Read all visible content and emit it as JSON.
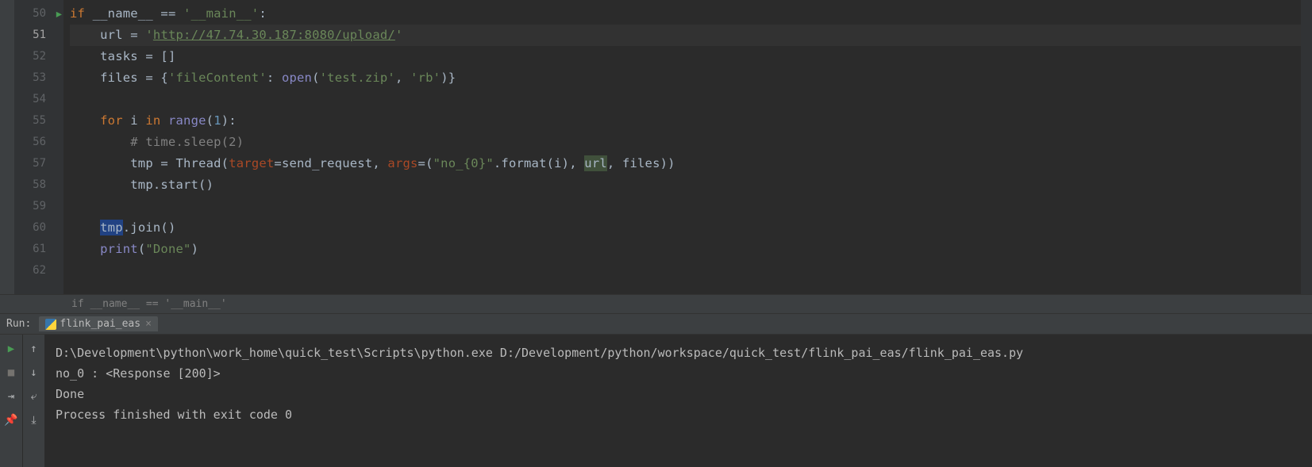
{
  "gutter": {
    "lines": [
      50,
      51,
      52,
      53,
      54,
      55,
      56,
      57,
      58,
      59,
      60,
      61,
      62
    ],
    "current": 51
  },
  "code": {
    "l50": {
      "kw_if": "if",
      "name": " __name__ ",
      "eq": "== ",
      "str": "'__main__'",
      "colon": ":"
    },
    "l51": {
      "var": "url ",
      "eq": "= ",
      "q1": "'",
      "url": "http://47.74.30.187:8080/upload/",
      "q2": "'"
    },
    "l52": {
      "var": "tasks ",
      "eq": "= ",
      "brk": "[]"
    },
    "l53": {
      "var": "files ",
      "eq": "= {",
      "key": "'fileContent'",
      "colon": ": ",
      "open": "open",
      "p1": "(",
      "s1": "'test.zip'",
      "comma": ", ",
      "s2": "'rb'",
      "p2": ")}"
    },
    "l55": {
      "for": "for ",
      "i": "i ",
      "in": "in ",
      "range": "range",
      "p1": "(",
      "n": "1",
      "p2": "):"
    },
    "l56": {
      "c": "# time.sleep(2)"
    },
    "l57": {
      "tmp": "tmp ",
      "eq": "= ",
      "th": "Thread(",
      "target": "target",
      "eq2": "=send_request, ",
      "args": "args",
      "eq3": "=(",
      "s": "\"no_{0}\"",
      "fmt": ".format(i), ",
      "url": "url",
      "rest": ", files))"
    },
    "l58": {
      "txt": "tmp.start()"
    },
    "l60": {
      "tmp": "tmp",
      "rest": ".join()"
    },
    "l61": {
      "print": "print",
      "p1": "(",
      "s": "\"Done\"",
      "p2": ")"
    }
  },
  "breadcrumb": {
    "text": "if __name__ == '__main__'"
  },
  "run": {
    "label": "Run:",
    "tab_name": "flink_pai_eas",
    "console_lines": [
      "D:\\Development\\python\\work_home\\quick_test\\Scripts\\python.exe D:/Development/python/workspace/quick_test/flink_pai_eas/flink_pai_eas.py",
      "no_0 : <Response [200]>",
      "Done",
      "",
      "Process finished with exit code 0"
    ]
  }
}
